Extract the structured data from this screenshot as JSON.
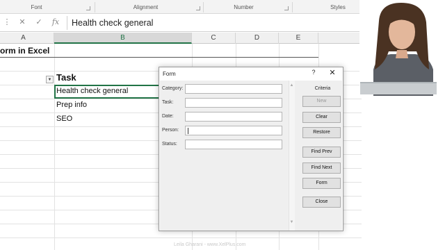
{
  "ribbon": {
    "groups": [
      {
        "label": "Font"
      },
      {
        "label": "Alignment"
      },
      {
        "label": "Number"
      },
      {
        "label": "Styles"
      }
    ]
  },
  "formula_bar": {
    "fx_label": "fx",
    "value": "Health check general"
  },
  "columns": [
    "A",
    "B",
    "C",
    "D",
    "E"
  ],
  "sheet": {
    "title": "orm in Excel",
    "task_header": "Task",
    "tasks": [
      "Health check general",
      "Prep info",
      "SEO"
    ]
  },
  "dialog": {
    "title": "Form",
    "help": "?",
    "close": "✕",
    "fields": [
      {
        "label": "Category:",
        "value": ""
      },
      {
        "label": "Task:",
        "value": ""
      },
      {
        "label": "Date:",
        "value": ""
      },
      {
        "label": "Person:",
        "value": ""
      },
      {
        "label": "Status:",
        "value": ""
      }
    ],
    "criteria": "Criteria",
    "buttons": {
      "new": "New",
      "clear": "Clear",
      "restore": "Restore",
      "find_prev": "Find Prev",
      "find_next": "Find Next",
      "form": "Form",
      "close": "Close"
    }
  },
  "watermark": "Leila Gharani - www.XelPlus.com",
  "colors": {
    "excel_green": "#217346",
    "dialog_bg": "#efefef",
    "button_bg": "#e1e1e1"
  }
}
